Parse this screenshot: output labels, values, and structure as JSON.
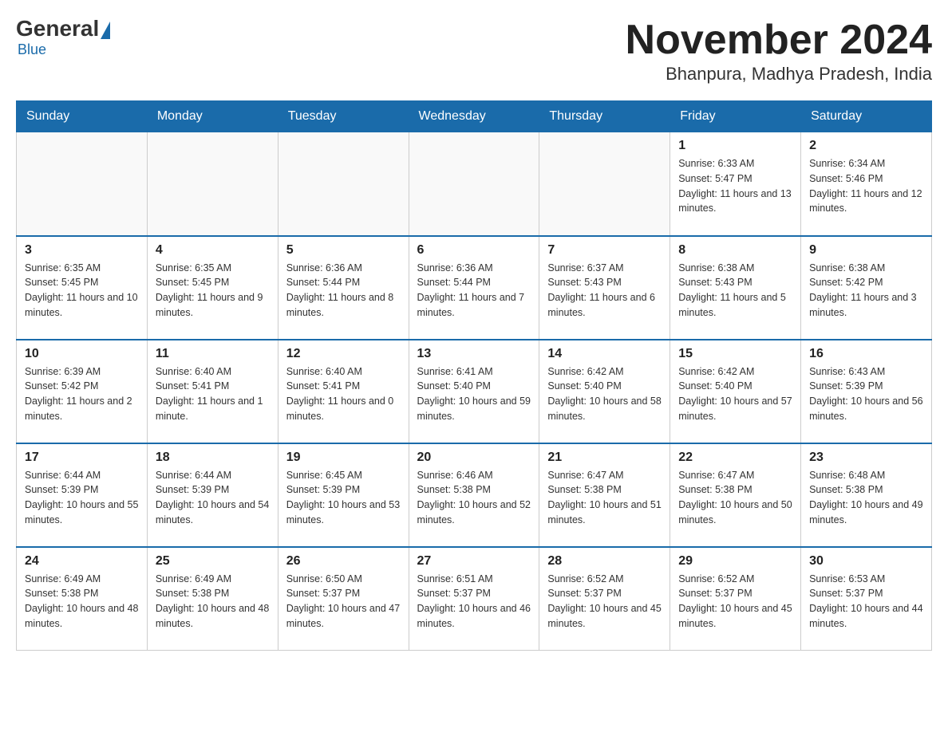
{
  "header": {
    "logo_general": "General",
    "logo_blue": "Blue",
    "month_title": "November 2024",
    "location": "Bhanpura, Madhya Pradesh, India"
  },
  "days_of_week": [
    "Sunday",
    "Monday",
    "Tuesday",
    "Wednesday",
    "Thursday",
    "Friday",
    "Saturday"
  ],
  "weeks": [
    [
      {
        "day": "",
        "info": ""
      },
      {
        "day": "",
        "info": ""
      },
      {
        "day": "",
        "info": ""
      },
      {
        "day": "",
        "info": ""
      },
      {
        "day": "",
        "info": ""
      },
      {
        "day": "1",
        "info": "Sunrise: 6:33 AM\nSunset: 5:47 PM\nDaylight: 11 hours and 13 minutes."
      },
      {
        "day": "2",
        "info": "Sunrise: 6:34 AM\nSunset: 5:46 PM\nDaylight: 11 hours and 12 minutes."
      }
    ],
    [
      {
        "day": "3",
        "info": "Sunrise: 6:35 AM\nSunset: 5:45 PM\nDaylight: 11 hours and 10 minutes."
      },
      {
        "day": "4",
        "info": "Sunrise: 6:35 AM\nSunset: 5:45 PM\nDaylight: 11 hours and 9 minutes."
      },
      {
        "day": "5",
        "info": "Sunrise: 6:36 AM\nSunset: 5:44 PM\nDaylight: 11 hours and 8 minutes."
      },
      {
        "day": "6",
        "info": "Sunrise: 6:36 AM\nSunset: 5:44 PM\nDaylight: 11 hours and 7 minutes."
      },
      {
        "day": "7",
        "info": "Sunrise: 6:37 AM\nSunset: 5:43 PM\nDaylight: 11 hours and 6 minutes."
      },
      {
        "day": "8",
        "info": "Sunrise: 6:38 AM\nSunset: 5:43 PM\nDaylight: 11 hours and 5 minutes."
      },
      {
        "day": "9",
        "info": "Sunrise: 6:38 AM\nSunset: 5:42 PM\nDaylight: 11 hours and 3 minutes."
      }
    ],
    [
      {
        "day": "10",
        "info": "Sunrise: 6:39 AM\nSunset: 5:42 PM\nDaylight: 11 hours and 2 minutes."
      },
      {
        "day": "11",
        "info": "Sunrise: 6:40 AM\nSunset: 5:41 PM\nDaylight: 11 hours and 1 minute."
      },
      {
        "day": "12",
        "info": "Sunrise: 6:40 AM\nSunset: 5:41 PM\nDaylight: 11 hours and 0 minutes."
      },
      {
        "day": "13",
        "info": "Sunrise: 6:41 AM\nSunset: 5:40 PM\nDaylight: 10 hours and 59 minutes."
      },
      {
        "day": "14",
        "info": "Sunrise: 6:42 AM\nSunset: 5:40 PM\nDaylight: 10 hours and 58 minutes."
      },
      {
        "day": "15",
        "info": "Sunrise: 6:42 AM\nSunset: 5:40 PM\nDaylight: 10 hours and 57 minutes."
      },
      {
        "day": "16",
        "info": "Sunrise: 6:43 AM\nSunset: 5:39 PM\nDaylight: 10 hours and 56 minutes."
      }
    ],
    [
      {
        "day": "17",
        "info": "Sunrise: 6:44 AM\nSunset: 5:39 PM\nDaylight: 10 hours and 55 minutes."
      },
      {
        "day": "18",
        "info": "Sunrise: 6:44 AM\nSunset: 5:39 PM\nDaylight: 10 hours and 54 minutes."
      },
      {
        "day": "19",
        "info": "Sunrise: 6:45 AM\nSunset: 5:39 PM\nDaylight: 10 hours and 53 minutes."
      },
      {
        "day": "20",
        "info": "Sunrise: 6:46 AM\nSunset: 5:38 PM\nDaylight: 10 hours and 52 minutes."
      },
      {
        "day": "21",
        "info": "Sunrise: 6:47 AM\nSunset: 5:38 PM\nDaylight: 10 hours and 51 minutes."
      },
      {
        "day": "22",
        "info": "Sunrise: 6:47 AM\nSunset: 5:38 PM\nDaylight: 10 hours and 50 minutes."
      },
      {
        "day": "23",
        "info": "Sunrise: 6:48 AM\nSunset: 5:38 PM\nDaylight: 10 hours and 49 minutes."
      }
    ],
    [
      {
        "day": "24",
        "info": "Sunrise: 6:49 AM\nSunset: 5:38 PM\nDaylight: 10 hours and 48 minutes."
      },
      {
        "day": "25",
        "info": "Sunrise: 6:49 AM\nSunset: 5:38 PM\nDaylight: 10 hours and 48 minutes."
      },
      {
        "day": "26",
        "info": "Sunrise: 6:50 AM\nSunset: 5:37 PM\nDaylight: 10 hours and 47 minutes."
      },
      {
        "day": "27",
        "info": "Sunrise: 6:51 AM\nSunset: 5:37 PM\nDaylight: 10 hours and 46 minutes."
      },
      {
        "day": "28",
        "info": "Sunrise: 6:52 AM\nSunset: 5:37 PM\nDaylight: 10 hours and 45 minutes."
      },
      {
        "day": "29",
        "info": "Sunrise: 6:52 AM\nSunset: 5:37 PM\nDaylight: 10 hours and 45 minutes."
      },
      {
        "day": "30",
        "info": "Sunrise: 6:53 AM\nSunset: 5:37 PM\nDaylight: 10 hours and 44 minutes."
      }
    ]
  ]
}
